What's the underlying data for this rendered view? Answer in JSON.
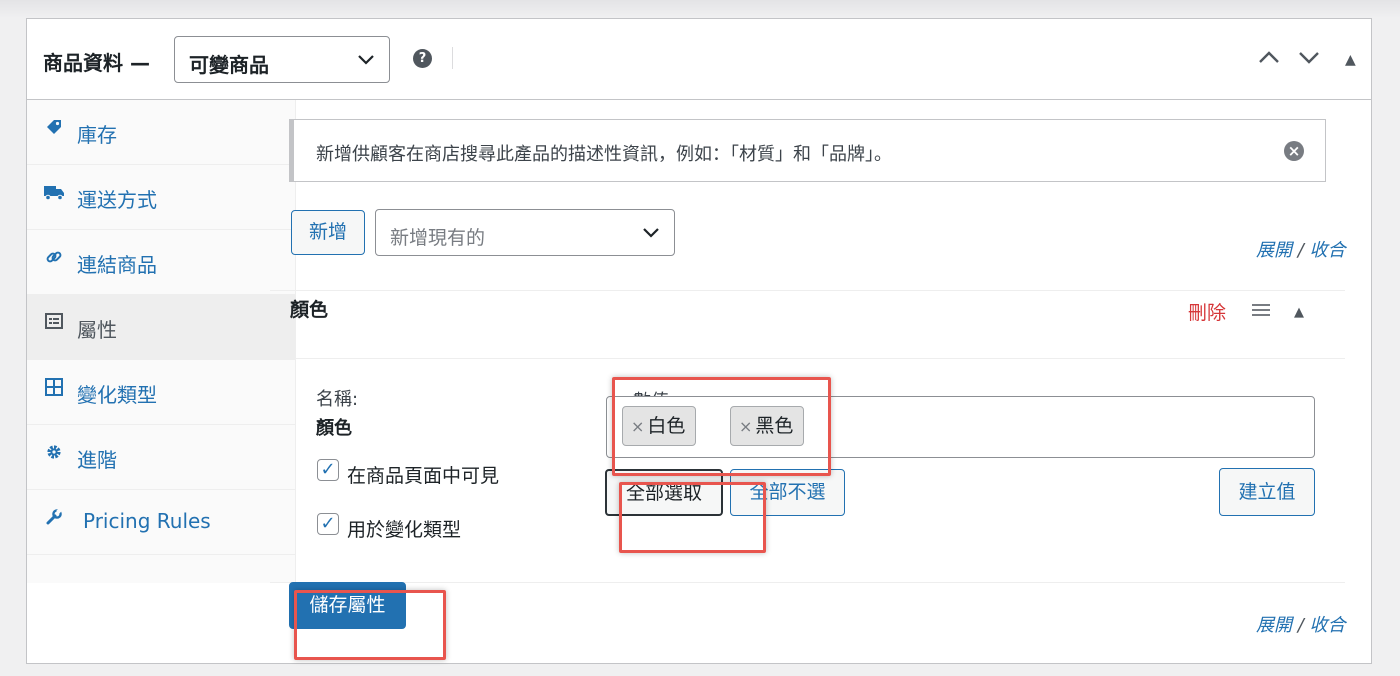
{
  "header": {
    "title": "商品資料 —",
    "product_type": "可變商品",
    "help": "?",
    "move_up": "^",
    "move_down": "⌄",
    "toggle": "▲"
  },
  "sidebar": {
    "items": [
      {
        "label": "庫存",
        "icon": "tag-icon"
      },
      {
        "label": "運送方式",
        "icon": "truck-icon"
      },
      {
        "label": "連結商品",
        "icon": "link-icon"
      },
      {
        "label": "屬性",
        "icon": "list-icon",
        "active": true
      },
      {
        "label": "變化類型",
        "icon": "grid-icon"
      },
      {
        "label": "進階",
        "icon": "gear-icon"
      },
      {
        "label": "Pricing Rules",
        "icon": "wrench-icon"
      }
    ]
  },
  "notice": {
    "text": "新增供顧客在商店搜尋此產品的描述性資訊，例如：「材質」和「品牌」。"
  },
  "toolbar": {
    "add_label": "新增",
    "existing_placeholder": "新增現有的",
    "expand": "展開",
    "separator": "/",
    "collapse": "收合"
  },
  "attribute": {
    "name": "顏色",
    "delete_label": "刪除",
    "name_label": "名稱:",
    "name_value": "顏色",
    "visible_label": "在商品頁面中可見",
    "visible_checked": true,
    "variation_label": "用於變化類型",
    "variation_checked": true,
    "values_label": "數值:",
    "values": [
      "白色",
      "黑色"
    ],
    "select_all": "全部選取",
    "select_none": "全部不選",
    "create_value": "建立值"
  },
  "footer": {
    "save_label": "儲存屬性",
    "expand": "展開",
    "separator": "/",
    "collapse": "收合"
  },
  "colors": {
    "accent": "#2271b1",
    "danger": "#d63638",
    "highlight": "#e8554e"
  }
}
